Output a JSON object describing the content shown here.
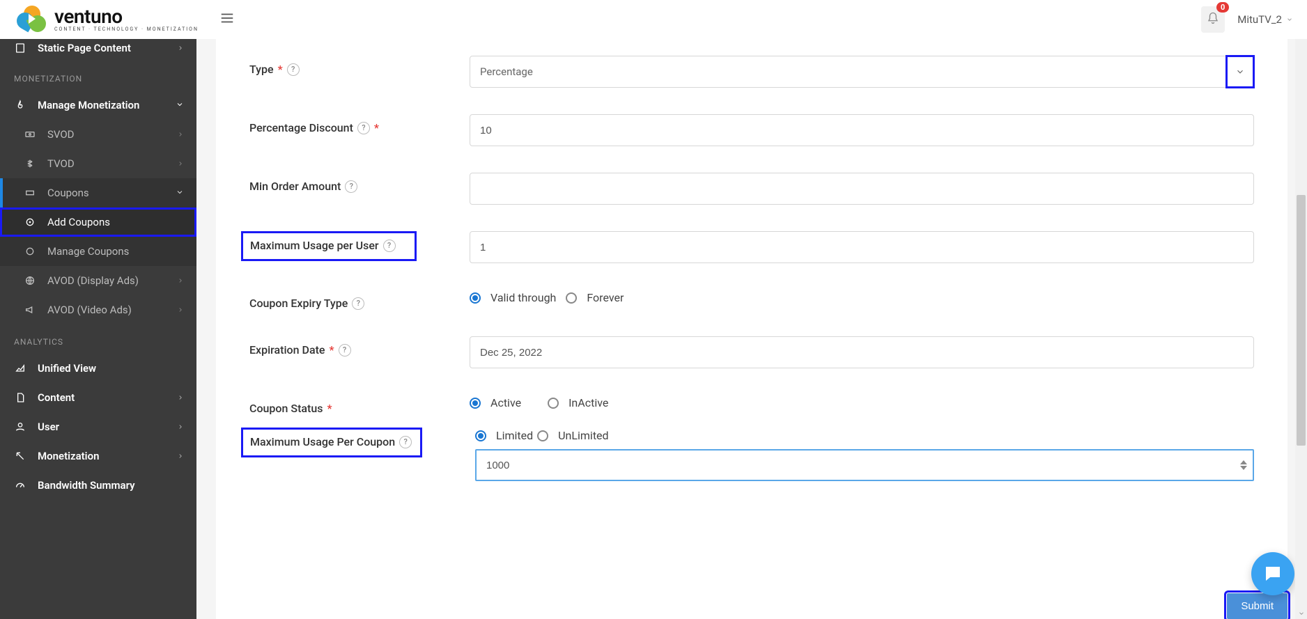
{
  "header": {
    "brand_name": "ventuno",
    "brand_tagline": "CONTENT · TECHNOLOGY · MONETIZATION",
    "notif_count": "0",
    "user_label": "MituTV_2"
  },
  "sidebar": {
    "top_cut_item": "Static Page Content",
    "section_monetization": "MONETIZATION",
    "manage_monetization": "Manage Monetization",
    "svod": "SVOD",
    "tvod": "TVOD",
    "coupons": "Coupons",
    "add_coupons": "Add Coupons",
    "manage_coupons": "Manage Coupons",
    "avod_display": "AVOD (Display Ads)",
    "avod_video": "AVOD (Video Ads)",
    "section_analytics": "ANALYTICS",
    "unified_view": "Unified View",
    "content": "Content",
    "user": "User",
    "monetization": "Monetization",
    "bandwidth": "Bandwidth Summary"
  },
  "form": {
    "type_label": "Type",
    "type_value": "Percentage",
    "pdisc_label": "Percentage Discount",
    "pdisc_value": "10",
    "minorder_label": "Min Order Amount",
    "minorder_value": "",
    "maxuser_label": "Maximum Usage per User",
    "maxuser_value": "1",
    "expiry_type_label": "Coupon Expiry Type",
    "expiry_valid_through": "Valid through",
    "expiry_forever": "Forever",
    "expdate_label": "Expiration Date",
    "expdate_value": "Dec 25, 2022",
    "status_label": "Coupon Status",
    "status_active": "Active",
    "status_inactive": "InActive",
    "maxcoupon_label": "Maximum Usage Per Coupon",
    "maxcoupon_limited": "Limited",
    "maxcoupon_unlimited": "UnLimited",
    "maxcoupon_value": "1000",
    "submit_label": "Submit"
  }
}
